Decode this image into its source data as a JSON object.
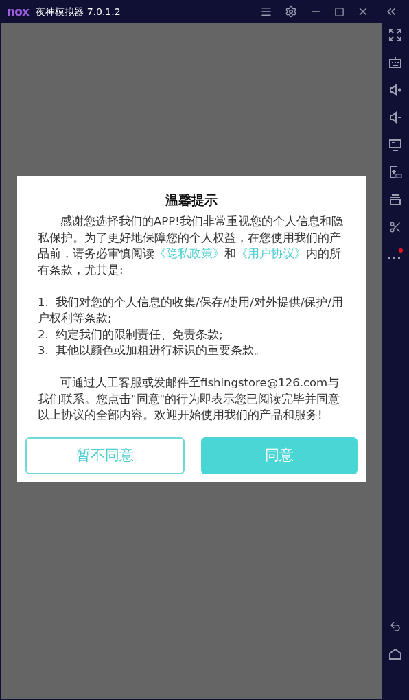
{
  "window": {
    "logo": "nox",
    "title": "夜神模拟器 7.0.1.2"
  },
  "dialog": {
    "title": "温馨提示",
    "intro": [
      {
        "kind": "text",
        "text": "感谢您选择我们的APP!我们非常重视您的个人信息和隐私保护。为了更好地保障您的个人权益，在您使用我们的产品前，请务必审慎阅读"
      },
      {
        "kind": "link",
        "text": "《隐私政策》"
      },
      {
        "kind": "text",
        "text": "和"
      },
      {
        "kind": "link",
        "text": "《用户协议》"
      },
      {
        "kind": "text",
        "text": "内的所有条款，尤其是:"
      }
    ],
    "items": [
      "1.  我们对您的个人信息的收集/保存/使用/对外提供/保护/用户权利等条款;",
      "2.  约定我们的限制责任、免责条款;",
      "3.  其他以颜色或加粗进行标识的重要条款。"
    ],
    "contact": "可通过人工客服或发邮件至fishingstore@126.com与我们联系。您点击\"同意\"的行为即表示您已阅读完毕并同意以上协议的全部内容。欢迎开始使用我们的产品和服务!",
    "buttons": [
      {
        "label": "暂不同意",
        "kind": "secondary"
      },
      {
        "label": "同意",
        "kind": "primary"
      }
    ]
  }
}
